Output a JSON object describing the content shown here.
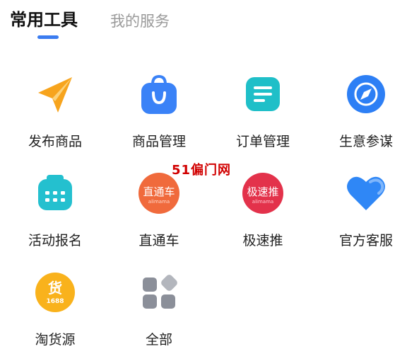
{
  "tabs": [
    {
      "label": "常用工具",
      "active": true
    },
    {
      "label": "我的服务",
      "active": false
    }
  ],
  "tools": [
    {
      "label": "发布商品",
      "icon": "paper-plane-icon"
    },
    {
      "label": "商品管理",
      "icon": "shopping-bag-icon"
    },
    {
      "label": "订单管理",
      "icon": "order-list-icon"
    },
    {
      "label": "生意参谋",
      "icon": "compass-icon"
    },
    {
      "label": "活动报名",
      "icon": "calendar-icon"
    },
    {
      "label": "直通车",
      "icon": "zhitongche-badge-icon",
      "badge_text": "直通车",
      "badge_sub": "alimama"
    },
    {
      "label": "极速推",
      "icon": "jisutui-badge-icon",
      "badge_text": "极速推",
      "badge_sub": "alimama"
    },
    {
      "label": "官方客服",
      "icon": "heart-icon"
    },
    {
      "label": "淘货源",
      "icon": "taohuoyuan-icon",
      "badge_text": "货",
      "badge_sub": "1688"
    },
    {
      "label": "全部",
      "icon": "all-apps-grid-icon"
    }
  ],
  "watermark": "51偏门网",
  "colors": {
    "accent": "#3b7cf0",
    "plane": "#f7a41d",
    "bag": "#3a82f7",
    "order": "#1fbfc8",
    "compass": "#2d7ff5",
    "calendar": "#24c0cf",
    "zhitongche": "#f06a3c",
    "jisutui": "#e3324b",
    "heart": "#2f87f6",
    "taohuoyuan": "#f9b21c",
    "grid": "#8b8f99"
  }
}
